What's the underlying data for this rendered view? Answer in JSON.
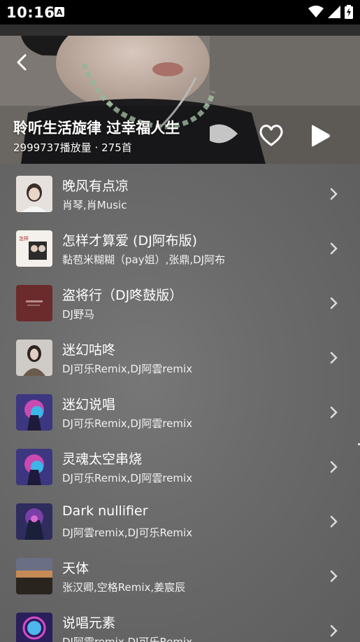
{
  "status_bar": {
    "time": "10:16",
    "notification_icon": "a-icon",
    "icons": [
      "wifi-icon",
      "signal-icon",
      "battery-charging-icon"
    ]
  },
  "header": {
    "back_icon": "chevron-left-icon",
    "title": "聆听生活旋律 过幸福人生",
    "meta": "2999737播放量 · 275首",
    "like_icon": "heart-outline-icon",
    "play_icon": "play-icon"
  },
  "songs": [
    {
      "title": "晚风有点凉",
      "artist": "肖琴,肖Music",
      "cover_color": "#d9d4cf"
    },
    {
      "title": "怎样才算爱 (DJ阿布版)",
      "artist": "黏苞米糊糊（pay姐）,张鼎,DJ阿布",
      "cover_color": "#f2efe9"
    },
    {
      "title": "盗将行（DJ咚鼓版）",
      "artist": "DJ野马",
      "cover_color": "#6b2b2d"
    },
    {
      "title": "迷幻咕咚",
      "artist": "DJ可乐Remix,DJ阿雲remix",
      "cover_color": "#c9c5c0"
    },
    {
      "title": "迷幻说唱",
      "artist": "DJ可乐Remix,DJ阿雲remix",
      "cover_color": "#4a3b8a"
    },
    {
      "title": "灵魂太空串烧",
      "artist": "DJ可乐Remix,DJ阿雲remix",
      "cover_color": "#4a3b8a"
    },
    {
      "title": "Dark nullifier",
      "artist": "DJ阿雲remix,DJ可乐Remix",
      "cover_color": "#3d3a6e"
    },
    {
      "title": "天体",
      "artist": "张汉卿,空格Remix,姜宸辰",
      "cover_color": "#5a4a3a"
    },
    {
      "title": "说唱元素",
      "artist": "DJ阿雲remix,DJ可乐Remix",
      "cover_color": "#6a2a8a"
    }
  ]
}
